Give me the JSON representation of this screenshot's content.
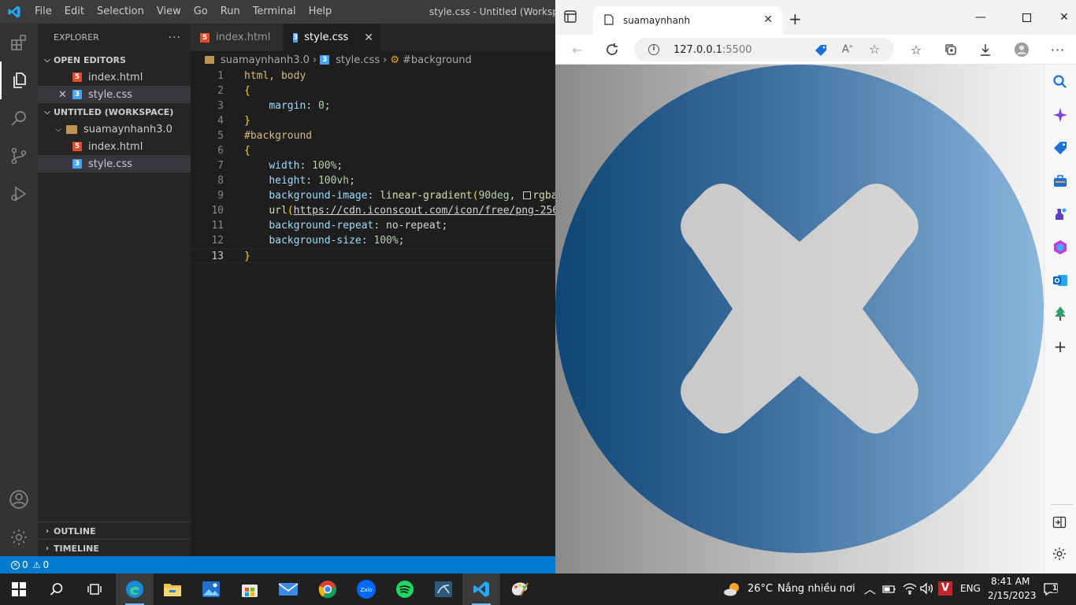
{
  "vscode": {
    "menu": [
      "File",
      "Edit",
      "Selection",
      "View",
      "Go",
      "Run",
      "Terminal",
      "Help"
    ],
    "window_title": "style.css - Untitled (Workspace",
    "explorer_title": "EXPLORER",
    "open_editors_title": "OPEN EDITORS",
    "open_editors": [
      "index.html",
      "style.css"
    ],
    "workspace_title": "UNTITLED (WORKSPACE)",
    "folder_name": "suamaynhanh3.0",
    "files": [
      "index.html",
      "style.css"
    ],
    "outline_title": "OUTLINE",
    "timeline_title": "TIMELINE",
    "tabs": [
      "index.html",
      "style.css"
    ],
    "breadcrumbs": [
      "suamaynhanh3.0",
      "style.css",
      "#background"
    ],
    "code": {
      "l1": "html, body",
      "l2": "{",
      "l3_prop": "margin",
      "l3_val": "0",
      "l4": "}",
      "l5": "#background",
      "l6": "{",
      "l7_prop": "width",
      "l7_val": "100%",
      "l8_prop": "height",
      "l8_val": "100vh",
      "l9_prop": "background-image",
      "l9_fn": "linear-gradient",
      "l9_arg": "90deg",
      "l9_tail": "rgba",
      "l10_fn": "url",
      "l10_url": "https://cdn.iconscout.com/icon/free/png-256",
      "l11_prop": "background-repeat",
      "l11_val": "no-repeat",
      "l12_prop": "background-size",
      "l12_val": "100%",
      "l13": "}"
    },
    "status": {
      "errors": "0",
      "warnings": "0"
    }
  },
  "browser": {
    "tab_title": "suamaynhanh",
    "url_host": "127.0.0.1",
    "url_port": ":5500"
  },
  "taskbar": {
    "weather_temp": "26°C",
    "weather_desc": "Nắng nhiều nơi",
    "lang": "ENG",
    "time": "8:41 AM",
    "date": "2/15/2023",
    "notification_count": "1"
  },
  "colors": {
    "vscode_accent": "#007acc",
    "icon_blue": "#1f5f96",
    "icon_blue_light": "#7aaad0"
  }
}
